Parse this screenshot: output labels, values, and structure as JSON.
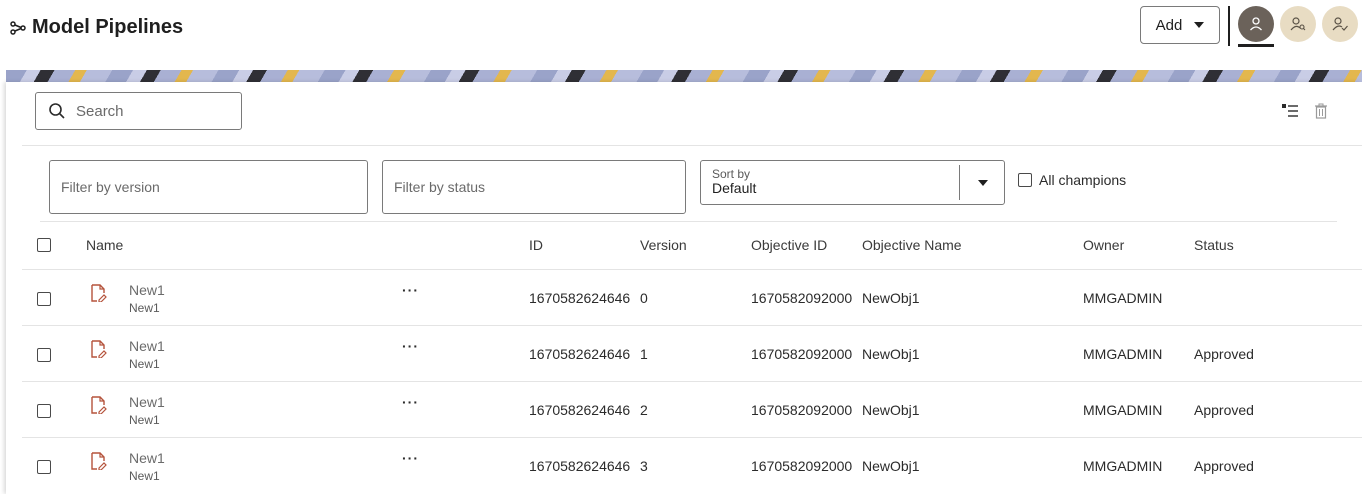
{
  "header": {
    "title": "Model Pipelines",
    "add_label": "Add"
  },
  "toolbar": {
    "search_placeholder": "Search"
  },
  "filters": {
    "version_placeholder": "Filter by version",
    "status_placeholder": "Filter by status",
    "sort_label": "Sort by",
    "sort_value": "Default",
    "champions_label": "All champions"
  },
  "table": {
    "columns": [
      "Name",
      "ID",
      "Version",
      "Objective ID",
      "Objective Name",
      "Owner",
      "Status"
    ],
    "rows": [
      {
        "name": "New1",
        "subname": "New1",
        "id": "1670582624646",
        "version": "0",
        "objective_id": "1670582092000",
        "objective_name": "NewObj1",
        "owner": "MMGADMIN",
        "status": ""
      },
      {
        "name": "New1",
        "subname": "New1",
        "id": "1670582624646",
        "version": "1",
        "objective_id": "1670582092000",
        "objective_name": "NewObj1",
        "owner": "MMGADMIN",
        "status": "Approved"
      },
      {
        "name": "New1",
        "subname": "New1",
        "id": "1670582624646",
        "version": "2",
        "objective_id": "1670582092000",
        "objective_name": "NewObj1",
        "owner": "MMGADMIN",
        "status": "Approved"
      },
      {
        "name": "New1",
        "subname": "New1",
        "id": "1670582624646",
        "version": "3",
        "objective_id": "1670582092000",
        "objective_name": "NewObj1",
        "owner": "MMGADMIN",
        "status": "Approved"
      }
    ]
  },
  "colors": {
    "accent_avatar": "#6b625a",
    "inactive_avatar": "#e8dcc3",
    "doc_icon": "#b5533c"
  }
}
